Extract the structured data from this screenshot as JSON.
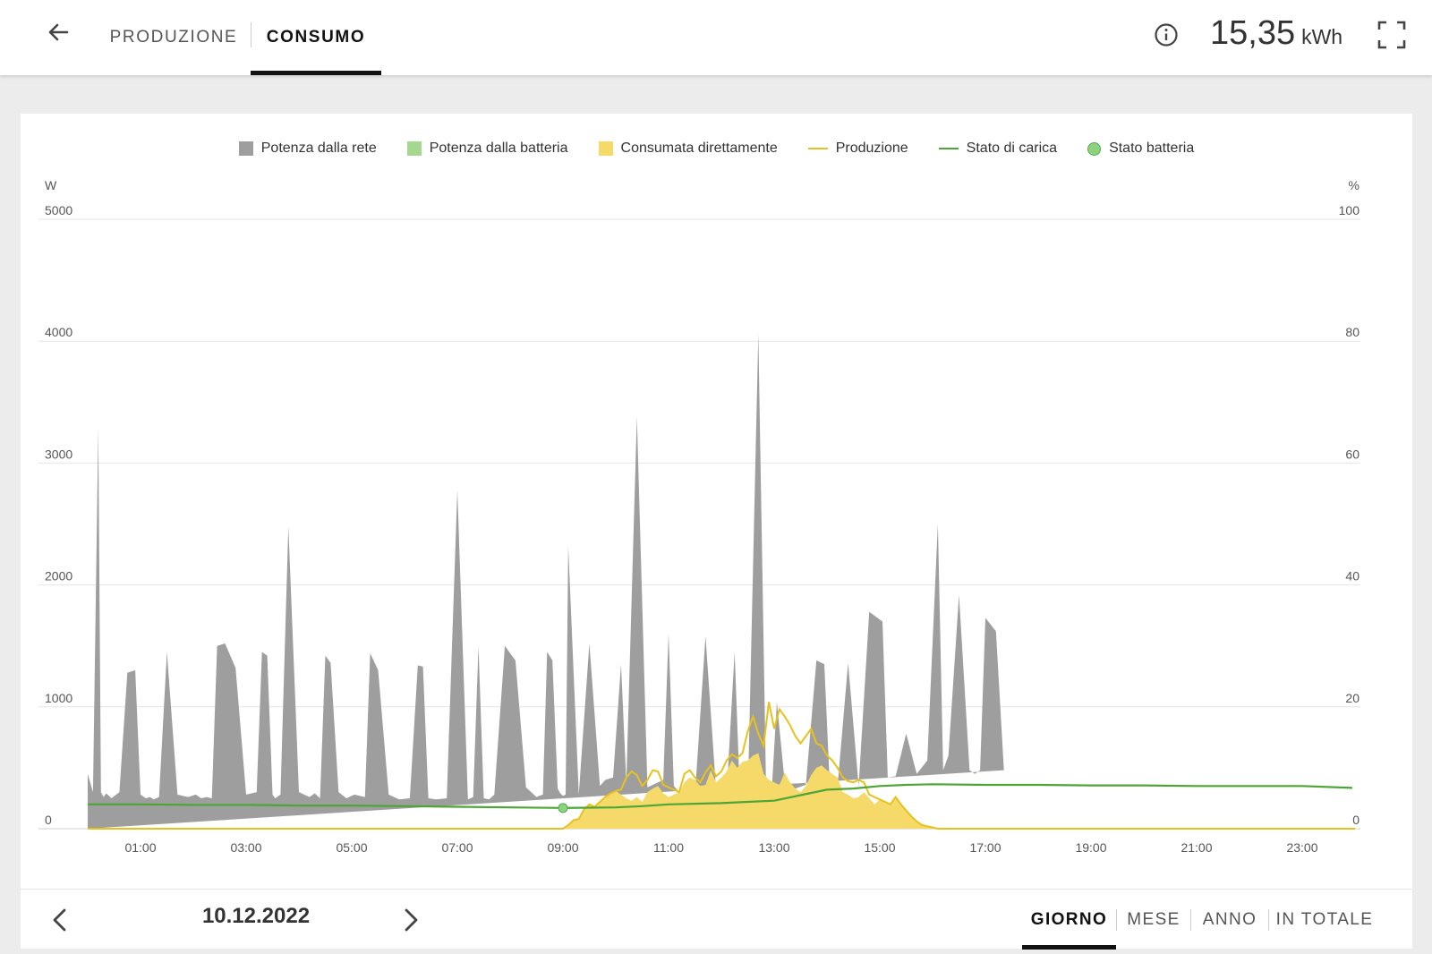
{
  "header": {
    "tabs": [
      {
        "label": "PRODUZIONE",
        "active": false
      },
      {
        "label": "CONSUMO",
        "active": true
      }
    ],
    "total_value": "15,35",
    "total_unit": "kWh"
  },
  "icons": {
    "back": "arrow-left-icon",
    "info": "info-circle-icon",
    "fullscreen": "fullscreen-icon",
    "prev": "chevron-left-icon",
    "next": "chevron-right-icon"
  },
  "colors": {
    "grid_power": "#9e9e9e",
    "battery_power": "#a5d88f",
    "direct_consumption": "#f5da6a",
    "production_line": "#e8c21c",
    "charge_state_line": "#4ca535",
    "battery_state_dot": "#8fd17c"
  },
  "footer": {
    "date": "10.12.2022",
    "periods": [
      {
        "label": "GIORNO",
        "active": true
      },
      {
        "label": "MESE",
        "active": false
      },
      {
        "label": "ANNO",
        "active": false
      },
      {
        "label": "IN TOTALE",
        "active": false
      }
    ]
  },
  "chart_data": {
    "type": "area",
    "legend": [
      {
        "label": "Potenza dalla rete",
        "kind": "square",
        "color": "#9e9e9e"
      },
      {
        "label": "Potenza dalla batteria",
        "kind": "square",
        "color": "#a5d88f"
      },
      {
        "label": "Consumata direttamente",
        "kind": "square",
        "color": "#f5da6a"
      },
      {
        "label": "Produzione",
        "kind": "line",
        "color": "#e8c21c"
      },
      {
        "label": "Stato di carica",
        "kind": "line",
        "color": "#4ca535"
      },
      {
        "label": "Stato batteria",
        "kind": "dot",
        "color": "#8fd17c"
      }
    ],
    "legend_position": "top-center",
    "x_range": [
      0,
      24
    ],
    "x_ticks": [
      "01:00",
      "03:00",
      "05:00",
      "07:00",
      "09:00",
      "11:00",
      "13:00",
      "15:00",
      "17:00",
      "19:00",
      "21:00",
      "23:00"
    ],
    "x_tick_hours": [
      1,
      3,
      5,
      7,
      9,
      11,
      13,
      15,
      17,
      19,
      21,
      23
    ],
    "y_left": {
      "unit": "W",
      "range": [
        0,
        5000
      ],
      "ticks": [
        "0",
        "1000",
        "2000",
        "3000",
        "4000",
        "5000"
      ]
    },
    "y_right": {
      "unit": "%",
      "range": [
        0,
        100
      ],
      "ticks": [
        "0",
        "20",
        "40",
        "60",
        "80",
        "100"
      ]
    },
    "grid": true,
    "series": [
      {
        "name": "Potenza dalla rete",
        "axis": "left",
        "x_hours": [
          0.0,
          0.1,
          0.2,
          0.25,
          0.3,
          0.35,
          0.45,
          0.6,
          0.75,
          0.9,
          1.0,
          1.1,
          1.18,
          1.25,
          1.35,
          1.5,
          1.7,
          1.9,
          2.05,
          2.15,
          2.25,
          2.35,
          2.45,
          2.6,
          2.8,
          3.0,
          3.2,
          3.3,
          3.4,
          3.5,
          3.55,
          3.65,
          3.8,
          4.0,
          4.2,
          4.3,
          4.4,
          4.5,
          4.6,
          4.75,
          4.9,
          5.05,
          5.15,
          5.25,
          5.35,
          5.5,
          5.7,
          5.9,
          6.1,
          6.25,
          6.35,
          6.45,
          6.6,
          6.8,
          7.0,
          7.2,
          7.3,
          7.4,
          7.5,
          7.6,
          7.7,
          7.9,
          8.1,
          8.3,
          8.45,
          8.5,
          8.55,
          8.62,
          8.7,
          8.8,
          8.9,
          8.95,
          9.0,
          9.05,
          9.1,
          9.3,
          9.5,
          9.7,
          9.8,
          9.95,
          10.1,
          10.2,
          10.4,
          10.6,
          10.8,
          10.9,
          11.0,
          11.1,
          11.2,
          11.3,
          11.5,
          11.7,
          11.9,
          12.1,
          12.25,
          12.35,
          12.5,
          12.7,
          12.85,
          12.95,
          13.05,
          13.2,
          13.4,
          13.6,
          13.8,
          13.95,
          14.05,
          14.2,
          14.4,
          14.6,
          14.8,
          15.05,
          15.15,
          15.3,
          15.5,
          15.7,
          15.9,
          16.1,
          16.2,
          16.3,
          16.5,
          16.7,
          16.8,
          16.9,
          17.0,
          17.2,
          17.35,
          17.5,
          17.7,
          17.9,
          18.1,
          18.25,
          18.35,
          18.5,
          18.7,
          18.9,
          19.15,
          19.25,
          19.35,
          19.5,
          19.7,
          19.9,
          20.1,
          20.35,
          20.45,
          20.55,
          20.7,
          20.9,
          21.1,
          21.25,
          21.45,
          21.6,
          21.75,
          21.85,
          21.95,
          22.05,
          22.15,
          22.3,
          22.5,
          22.7,
          22.9,
          23.1,
          23.25,
          23.35,
          23.5,
          23.7,
          23.9
        ],
        "values": [
          450,
          300,
          3280,
          300,
          260,
          290,
          250,
          300,
          1280,
          1300,
          280,
          250,
          260,
          240,
          260,
          1450,
          280,
          260,
          280,
          250,
          260,
          250,
          1500,
          1520,
          1320,
          280,
          300,
          1450,
          1420,
          280,
          250,
          280,
          2480,
          300,
          260,
          290,
          250,
          1420,
          1360,
          300,
          250,
          280,
          270,
          260,
          1440,
          1300,
          280,
          240,
          250,
          1340,
          1330,
          250,
          240,
          250,
          2780,
          240,
          260,
          1500,
          250,
          240,
          280,
          1500,
          1380,
          340,
          280,
          260,
          270,
          280,
          1450,
          1380,
          330,
          290,
          270,
          280,
          2320,
          280,
          1520,
          350,
          400,
          420,
          1350,
          380,
          3380,
          340,
          380,
          400,
          1600,
          350,
          300,
          260,
          280,
          1580,
          320,
          290,
          1450,
          300,
          250,
          4060,
          260,
          280,
          1040,
          380,
          330,
          360,
          1380,
          1350,
          380,
          350,
          1360,
          350,
          1780,
          1700,
          420,
          430,
          780,
          450,
          560,
          2500,
          480,
          600,
          1920,
          480,
          450,
          480,
          1730,
          1620,
          480
        ]
      },
      {
        "name": "Consumata direttamente",
        "axis": "left",
        "x_hours": [
          9.0,
          9.1,
          9.2,
          9.3,
          9.4,
          9.5,
          9.6,
          9.7,
          9.8,
          9.9,
          10.0,
          10.1,
          10.2,
          10.3,
          10.4,
          10.5,
          10.6,
          10.7,
          10.8,
          10.9,
          11.0,
          11.1,
          11.2,
          11.3,
          11.4,
          11.5,
          11.6,
          11.7,
          11.8,
          11.9,
          12.0,
          12.1,
          12.2,
          12.3,
          12.4,
          12.5,
          12.6,
          12.7,
          12.8,
          12.9,
          13.0,
          13.1,
          13.2,
          13.3,
          13.4,
          13.5,
          13.6,
          13.7,
          13.8,
          13.9,
          14.0,
          14.1,
          14.2,
          14.3,
          14.4,
          14.5,
          14.6,
          14.7,
          14.8,
          14.9,
          15.0,
          15.1,
          15.2,
          15.3,
          15.4,
          15.5,
          15.6,
          15.7,
          15.8,
          15.9,
          16.0,
          16.1,
          16.2,
          16.3,
          16.4,
          16.5,
          16.6,
          16.7,
          16.8,
          16.9,
          17.0
        ],
        "values": [
          0,
          30,
          70,
          80,
          160,
          200,
          180,
          220,
          260,
          290,
          310,
          280,
          250,
          230,
          260,
          220,
          300,
          330,
          350,
          290,
          260,
          280,
          300,
          380,
          420,
          400,
          350,
          360,
          480,
          380,
          420,
          470,
          560,
          500,
          550,
          560,
          600,
          620,
          450,
          400,
          380,
          360,
          460,
          380,
          330,
          300,
          350,
          440,
          500,
          520,
          480,
          450,
          420,
          300,
          280,
          250,
          260,
          300,
          250,
          200,
          240,
          220,
          200,
          260,
          200,
          150,
          100,
          60,
          30,
          20,
          10,
          0,
          0,
          0,
          0,
          0,
          0,
          0,
          0,
          0,
          0
        ]
      },
      {
        "name": "Produzione",
        "axis": "left",
        "x_hours": [
          0,
          9.0,
          9.1,
          9.2,
          9.3,
          9.4,
          9.5,
          9.6,
          9.7,
          9.8,
          9.9,
          10.0,
          10.1,
          10.2,
          10.3,
          10.4,
          10.5,
          10.6,
          10.7,
          10.8,
          10.9,
          11.0,
          11.1,
          11.2,
          11.3,
          11.4,
          11.5,
          11.6,
          11.7,
          11.8,
          11.9,
          12.0,
          12.1,
          12.2,
          12.3,
          12.4,
          12.5,
          12.6,
          12.7,
          12.8,
          12.9,
          13.0,
          13.1,
          13.2,
          13.3,
          13.4,
          13.5,
          13.6,
          13.7,
          13.8,
          13.9,
          14.0,
          14.1,
          14.2,
          14.3,
          14.4,
          14.5,
          14.6,
          14.7,
          14.8,
          14.9,
          15.0,
          15.1,
          15.2,
          15.3,
          15.4,
          15.5,
          15.6,
          15.7,
          15.8,
          15.9,
          16.0,
          16.1,
          16.2,
          16.3,
          16.4,
          16.5,
          16.6,
          16.7,
          16.8,
          16.9,
          17.0,
          24
        ],
        "values": [
          0,
          0,
          30,
          70,
          80,
          160,
          200,
          180,
          220,
          260,
          290,
          310,
          320,
          420,
          470,
          440,
          350,
          400,
          480,
          470,
          360,
          340,
          320,
          300,
          450,
          480,
          420,
          380,
          460,
          520,
          430,
          470,
          560,
          610,
          580,
          620,
          800,
          920,
          780,
          680,
          1040,
          820,
          980,
          920,
          850,
          760,
          700,
          760,
          820,
          700,
          680,
          600,
          560,
          500,
          420,
          390,
          380,
          400,
          380,
          280,
          260,
          240,
          220,
          200,
          260,
          200,
          150,
          100,
          60,
          30,
          20,
          10,
          0,
          0,
          0,
          0,
          0,
          0,
          0,
          0,
          0,
          0,
          0
        ]
      },
      {
        "name": "Stato di carica",
        "axis": "right",
        "x_hours": [
          0.0,
          1.0,
          2.0,
          3.0,
          4.0,
          5.0,
          6.0,
          7.0,
          8.0,
          9.0,
          10.0,
          10.5,
          11.0,
          12.0,
          12.5,
          13.0,
          13.5,
          14.0,
          14.5,
          15.0,
          15.5,
          16.0,
          17.0,
          18.0,
          19.0,
          20.0,
          21.0,
          22.0,
          23.0,
          23.95
        ],
        "values": [
          4.0,
          4.0,
          3.9,
          3.9,
          3.8,
          3.8,
          3.7,
          3.6,
          3.5,
          3.4,
          3.5,
          3.7,
          4.0,
          4.2,
          4.4,
          4.6,
          5.5,
          6.4,
          6.6,
          7.0,
          7.2,
          7.3,
          7.2,
          7.2,
          7.1,
          7.1,
          7.0,
          7.0,
          7.0,
          6.7
        ]
      },
      {
        "name": "Stato batteria",
        "axis": "right",
        "x_hours": [
          9.0
        ],
        "values": [
          3.4
        ]
      }
    ]
  }
}
